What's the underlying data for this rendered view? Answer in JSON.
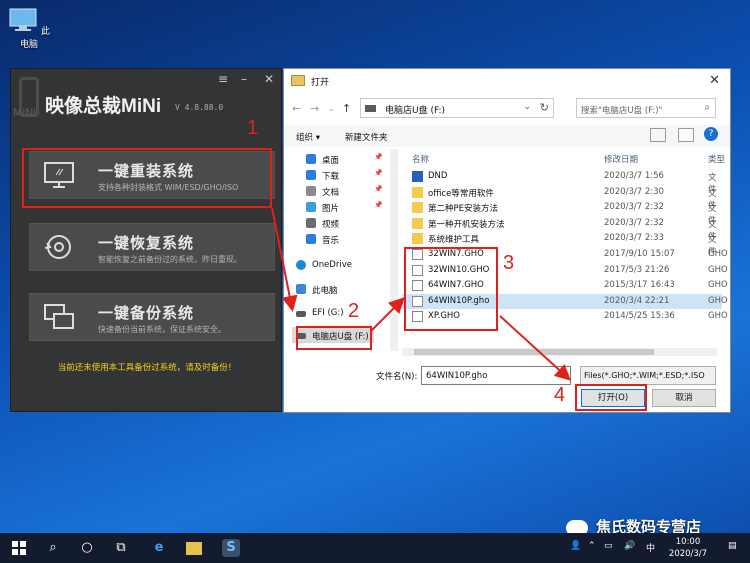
{
  "desktop": {
    "icon_label": "此电脑"
  },
  "app": {
    "title": "映像总裁MiNi",
    "version": "V 4.8.88.0",
    "watermark": "MiNi",
    "cards": [
      {
        "title": "一键重装系统",
        "subtitle": "支持各种封装格式 WIM/ESD/GHO/ISO"
      },
      {
        "title": "一键恢复系统",
        "subtitle": "智能恢复之前备份过的系统，昨日重现。"
      },
      {
        "title": "一键备份系统",
        "subtitle": "快速备份当前系统，保证系统安全。"
      }
    ],
    "warning": "当前还未使用本工具备份过系统，请及时备份！"
  },
  "dialog": {
    "title": "打开",
    "address": "电脑店U盘 (F:)",
    "search_placeholder": "搜索\"电脑店U盘 (F:)\"",
    "organize": "组织 ▾",
    "new_folder": "新建文件夹",
    "nav_items": [
      {
        "label": "桌面",
        "color": "#2a7de1"
      },
      {
        "label": "下载",
        "color": "#2a7de1"
      },
      {
        "label": "文档",
        "color": "#8a8a8a"
      },
      {
        "label": "图片",
        "color": "#3b9de0"
      },
      {
        "label": "视频",
        "color": "#6c6c6c"
      },
      {
        "label": "音乐",
        "color": "#2a7de1"
      },
      {
        "label": "OneDrive",
        "color": "#1a8ad4"
      },
      {
        "label": "此电脑",
        "color": "#3a86d6"
      },
      {
        "label": "EFI (G:)",
        "color": "#5a5a5a"
      },
      {
        "label": "电脑店U盘 (F:)",
        "color": "#5a5a5a"
      }
    ],
    "columns": {
      "name": "名称",
      "date": "修改日期",
      "type": "类型"
    },
    "files": [
      {
        "name": "DND",
        "date": "2020/3/7 1:56",
        "type": "文件",
        "kind": "special"
      },
      {
        "name": "office等常用软件",
        "date": "2020/3/7 2:30",
        "type": "文件",
        "kind": "folder"
      },
      {
        "name": "第二种PE安装方法",
        "date": "2020/3/7 2:32",
        "type": "文件",
        "kind": "folder"
      },
      {
        "name": "第一种开机安装方法",
        "date": "2020/3/7 2:32",
        "type": "文件",
        "kind": "folder"
      },
      {
        "name": "系统维护工具",
        "date": "2020/3/7 2:33",
        "type": "文件",
        "kind": "folder"
      },
      {
        "name": "32WIN7.GHO",
        "date": "2017/9/10 15:07",
        "type": "GHO",
        "kind": "file"
      },
      {
        "name": "32WIN10.GHO",
        "date": "2017/5/3 21:26",
        "type": "GHO",
        "kind": "file"
      },
      {
        "name": "64WIN7.GHO",
        "date": "2015/3/17 16:43",
        "type": "GHO",
        "kind": "file"
      },
      {
        "name": "64WIN10P.gho",
        "date": "2020/3/4 22:21",
        "type": "GHO",
        "kind": "file"
      },
      {
        "name": "XP.GHO",
        "date": "2014/5/25 15:36",
        "type": "GHO",
        "kind": "file"
      }
    ],
    "filename_label": "文件名(N):",
    "filename_value": "64WIN10P.gho",
    "filetype": "Files(*.GHO;*.WIM;*.ESD;*.ISO",
    "open_button": "打开(O)",
    "cancel_button": "取消"
  },
  "annotations": [
    "1",
    "2",
    "3",
    "4"
  ],
  "taskbar": {
    "time": "10:00",
    "date": "2020/3/7",
    "ime": "中"
  },
  "watermark": "焦氏数码专营店",
  "colors": {
    "accent": "#0078d7",
    "annotation": "#e0211b",
    "warning": "#f5d31a",
    "app_bg": "#333435"
  }
}
